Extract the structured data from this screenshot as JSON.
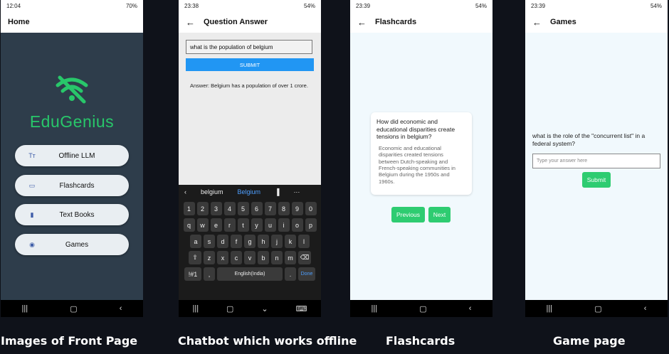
{
  "screens": {
    "home": {
      "status_time": "12:04",
      "status_battery": "70%",
      "title": "Home",
      "logo_text": "EduGenius",
      "menu": [
        {
          "label": "Offline LLM",
          "icon": "text-icon"
        },
        {
          "label": "Flashcards",
          "icon": "card-icon"
        },
        {
          "label": "Text Books",
          "icon": "book-icon"
        },
        {
          "label": "Games",
          "icon": "gamepad-icon"
        }
      ]
    },
    "qa": {
      "status_time": "23:38",
      "status_battery": "54%",
      "title": "Question Answer",
      "input_value": "what is the population of belgium",
      "submit_label": "SUBMIT",
      "answer": "Answer: Belgium has a population of over 1 crore.",
      "suggestions": [
        "belgium",
        "Belgium"
      ],
      "keys_row1": [
        "1",
        "2",
        "3",
        "4",
        "5",
        "6",
        "7",
        "8",
        "9",
        "0"
      ],
      "keys_row2": [
        "q",
        "w",
        "e",
        "r",
        "t",
        "y",
        "u",
        "i",
        "o",
        "p"
      ],
      "keys_row3": [
        "a",
        "s",
        "d",
        "f",
        "g",
        "h",
        "j",
        "k",
        "l"
      ],
      "keys_row4": [
        "z",
        "x",
        "c",
        "v",
        "b",
        "n",
        "m"
      ],
      "key_symbols": "!#1",
      "key_comma": ",",
      "key_space": "English(India)",
      "key_period": ".",
      "key_done": "Done"
    },
    "flashcards": {
      "status_time": "23:39",
      "status_battery": "54%",
      "title": "Flashcards",
      "question": "How did economic and educational disparities create tensions in belgium?",
      "answer": "Economic and educational disparities created tensions between Dutch-speaking and French-speaking communities in Belgium during the 1950s and 1960s.",
      "previous_label": "Previous",
      "next_label": "Next"
    },
    "games": {
      "status_time": "23:39",
      "status_battery": "54%",
      "title": "Games",
      "question": "what is the role of the \"concurrent list\" in a federal system?",
      "placeholder": "Type your answer here",
      "submit_label": "Submit"
    }
  },
  "captions": [
    "Images of Front Page",
    "Chatbot which works offline",
    "Flashcards",
    "Game page"
  ],
  "colors": {
    "brand_green": "#28c76a",
    "home_bg": "#2e3d4b",
    "submit_blue": "#2196f3",
    "button_green": "#2ecc71"
  }
}
